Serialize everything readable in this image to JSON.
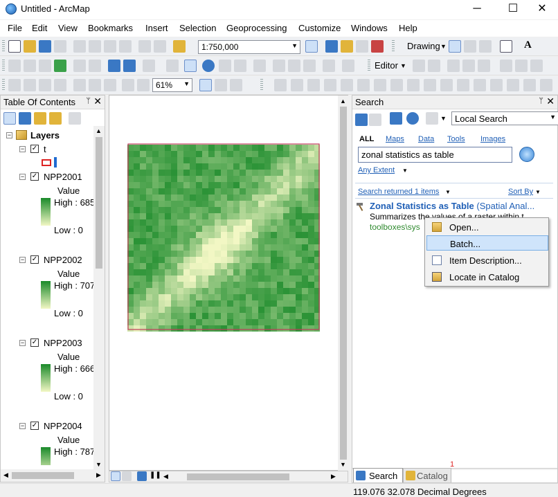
{
  "window": {
    "title": "Untitled - ArcMap",
    "minimize": "─",
    "maximize": "☐",
    "close": "✕"
  },
  "menu": [
    "File",
    "Edit",
    "View",
    "Bookmarks",
    "Insert",
    "Selection",
    "Geoprocessing",
    "Customize",
    "Windows",
    "Help"
  ],
  "toolbar": {
    "scale_value": "1:750,000",
    "drawing_label": "Drawing",
    "editor_label": "Editor",
    "zoom_value": "61%",
    "text_tool": "A"
  },
  "toc": {
    "header": "Table Of Contents",
    "pin": "ᛘ",
    "close": "✕",
    "root_label": "Layers",
    "layers": [
      {
        "name": "t",
        "value_label": "",
        "high": "",
        "low": ""
      },
      {
        "name": "NPP2001",
        "value_label": "Value",
        "high": "High : 685",
        "low": "Low : 0"
      },
      {
        "name": "NPP2002",
        "value_label": "Value",
        "high": "High : 707",
        "low": "Low : 0"
      },
      {
        "name": "NPP2003",
        "value_label": "Value",
        "high": "High : 666",
        "low": "Low : 0"
      },
      {
        "name": "NPP2004",
        "value_label": "Value",
        "high": "High : 787",
        "low": ""
      }
    ]
  },
  "search": {
    "header": "Search",
    "pin": "ᛘ",
    "close": "✕",
    "scope": "Local Search",
    "filters": [
      "ALL",
      "Maps",
      "Data",
      "Tools",
      "Images"
    ],
    "query": "zonal statistics as table",
    "extent": "Any Extent",
    "results_count": "Search returned 1 items",
    "sort_by": "Sort By",
    "result_title": "Zonal Statistics as Table",
    "result_category": "(Spatial Anal...",
    "result_summary": "Summarizes the values of a raster within t",
    "result_path": "toolboxes\\sys",
    "badge": "1"
  },
  "context_menu": [
    "Open...",
    "Batch...",
    "Item Description...",
    "Locate in Catalog"
  ],
  "bottom_tabs": {
    "search": "Search",
    "catalog": "Catalog"
  },
  "status": {
    "coords": "119.076  32.078 Decimal Degrees"
  },
  "colors": {
    "accent": "#3a78c4",
    "highlight": "#cfe4fb",
    "raster_dark": "#1a8a2a",
    "raster_light": "#f2f7c4"
  }
}
